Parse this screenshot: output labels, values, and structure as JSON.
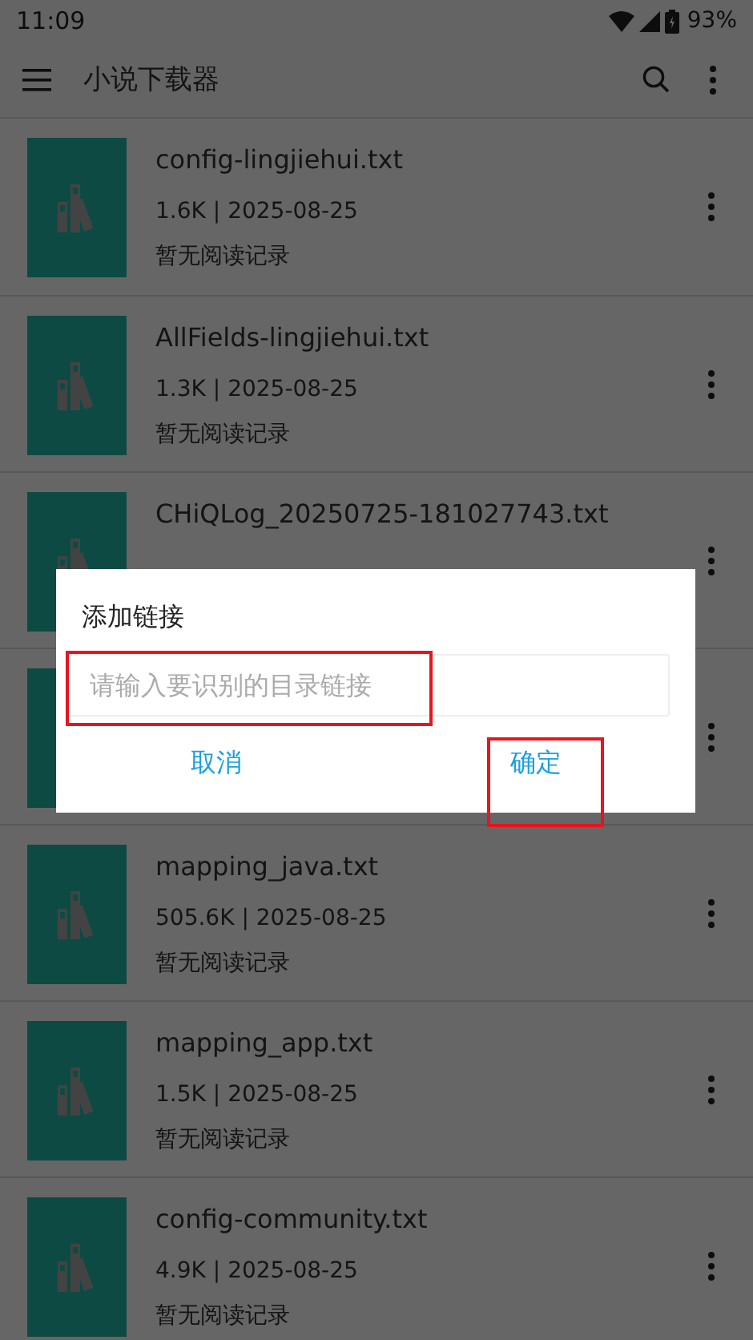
{
  "status_bar": {
    "time": "11:09",
    "battery": "93%"
  },
  "app_bar": {
    "title": "小说下载器"
  },
  "files": [
    {
      "kind": "file",
      "name": "config-lingjiehui.txt",
      "meta": "1.6K | 2025-08-25",
      "status": "暂无阅读记录"
    },
    {
      "kind": "file",
      "name": "AllFields-lingjiehui.txt",
      "meta": "1.3K | 2025-08-25",
      "status": "暂无阅读记录"
    },
    {
      "kind": "file",
      "name": "CHiQLog_20250725-181027743.txt"
    },
    {
      "kind": "covered"
    },
    {
      "kind": "file",
      "name": "mapping_java.txt",
      "meta": "505.6K | 2025-08-25",
      "status": "暂无阅读记录"
    },
    {
      "kind": "file",
      "name": "mapping_app.txt",
      "meta": "1.5K | 2025-08-25",
      "status": "暂无阅读记录"
    },
    {
      "kind": "file",
      "name": "config-community.txt",
      "meta": "4.9K | 2025-08-25",
      "status": "暂无阅读记录"
    }
  ],
  "dialog": {
    "title": "添加链接",
    "field": {
      "placeholder": "请输入要识别的目录链接",
      "highlighted": true
    },
    "buttons": [
      {
        "label": "取消",
        "highlighted": false
      },
      {
        "label": "确定",
        "highlighted": true
      }
    ]
  }
}
